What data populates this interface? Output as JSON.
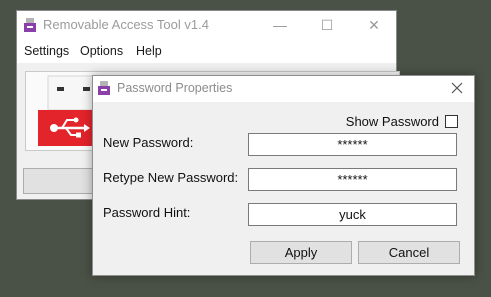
{
  "main_window": {
    "title": "Removable Access Tool v1.4",
    "menu": [
      "Settings",
      "Options",
      "Help"
    ],
    "usb_icon_color": "#e3242b"
  },
  "dialog": {
    "title": "Password Properties",
    "show_password_label": "Show Password",
    "show_password_checked": false,
    "fields": [
      {
        "label": "New Password:",
        "value": "******"
      },
      {
        "label": "Retype New Password:",
        "value": "******"
      },
      {
        "label": "Password Hint:",
        "value": "yuck"
      }
    ],
    "apply_label": "Apply",
    "cancel_label": "Cancel"
  }
}
